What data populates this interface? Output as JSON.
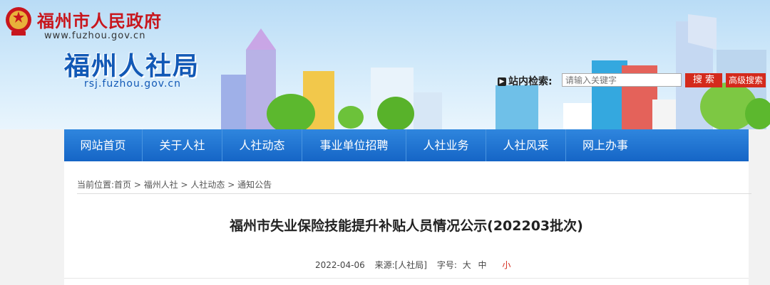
{
  "header": {
    "gov_title": "福州市人民政府",
    "gov_url": "www.fuzhou.gov.cn",
    "site_title": "福州人社局",
    "site_url": "rsj.fuzhou.gov.cn"
  },
  "search": {
    "label": "站内检索:",
    "placeholder": "请输入关键字",
    "button": "搜 索",
    "advanced": "高级搜索"
  },
  "nav": {
    "items": [
      {
        "label": "网站首页"
      },
      {
        "label": "关于人社"
      },
      {
        "label": "人社动态"
      },
      {
        "label": "事业单位招聘"
      },
      {
        "label": "人社业务"
      },
      {
        "label": "人社风采"
      },
      {
        "label": "网上办事"
      }
    ]
  },
  "breadcrumb": {
    "text": "当前位置:首页 > 福州人社 > 人社动态 > 通知公告"
  },
  "article": {
    "title": "福州市失业保险技能提升补贴人员情况公示(202203批次)",
    "date": "2022-04-06",
    "source": "来源:[人社局]",
    "font_label": "字号:",
    "font_large": "大",
    "font_medium": "中",
    "font_small": "小"
  },
  "colors": {
    "nav": "#1565c6",
    "gov_title": "#c8161d",
    "site_title": "#1259b6",
    "search_button": "#d42a1c"
  }
}
